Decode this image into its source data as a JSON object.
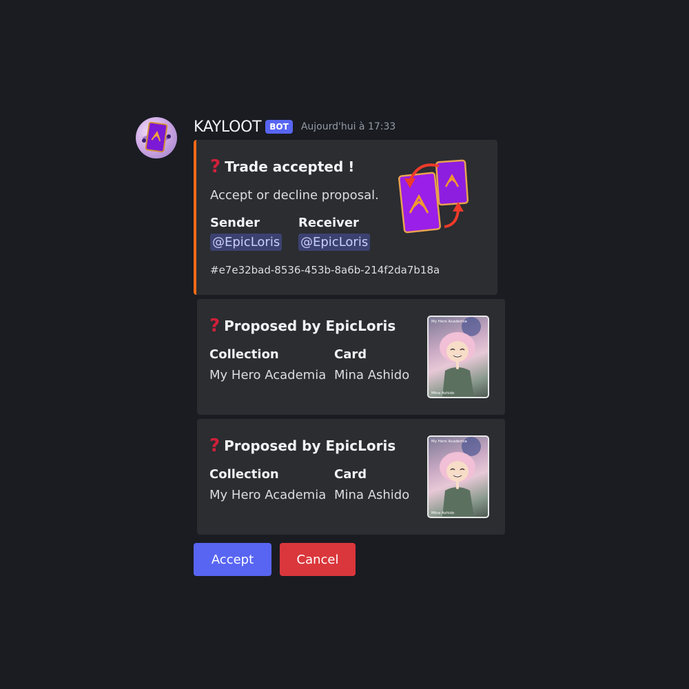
{
  "message": {
    "username": "KAYLOOT",
    "bot_tag": "BOT",
    "timestamp": "Aujourd'hui à 17:33"
  },
  "trade_embed": {
    "title": "Trade accepted !",
    "description": "Accept or decline proposal.",
    "sender_label": "Sender",
    "sender_value": "@EpicLoris",
    "receiver_label": "Receiver",
    "receiver_value": "@EpicLoris",
    "trade_id": "#e7e32bad-8536-453b-8a6b-214f2da7b18a",
    "accent_color": "#f26a16"
  },
  "cards": [
    {
      "title": "Proposed by EpicLoris",
      "collection_label": "Collection",
      "collection_value": "My Hero Academia",
      "card_label": "Card",
      "card_value": "Mina Ashido",
      "thumb_top_text": "My Hero Academia",
      "thumb_bottom_text": "Mina Ashido"
    },
    {
      "title": "Proposed by EpicLoris",
      "collection_label": "Collection",
      "collection_value": "My Hero Academia",
      "card_label": "Card",
      "card_value": "Mina Ashido",
      "thumb_top_text": "My Hero Academia",
      "thumb_bottom_text": "Mina Ashido"
    }
  ],
  "buttons": {
    "accept_label": "Accept",
    "cancel_label": "Cancel"
  },
  "icons": {
    "title_icon": "question-mark-icon",
    "avatar": "card-avatar-icon",
    "trade_thumbnail": "card-swap-icon"
  }
}
